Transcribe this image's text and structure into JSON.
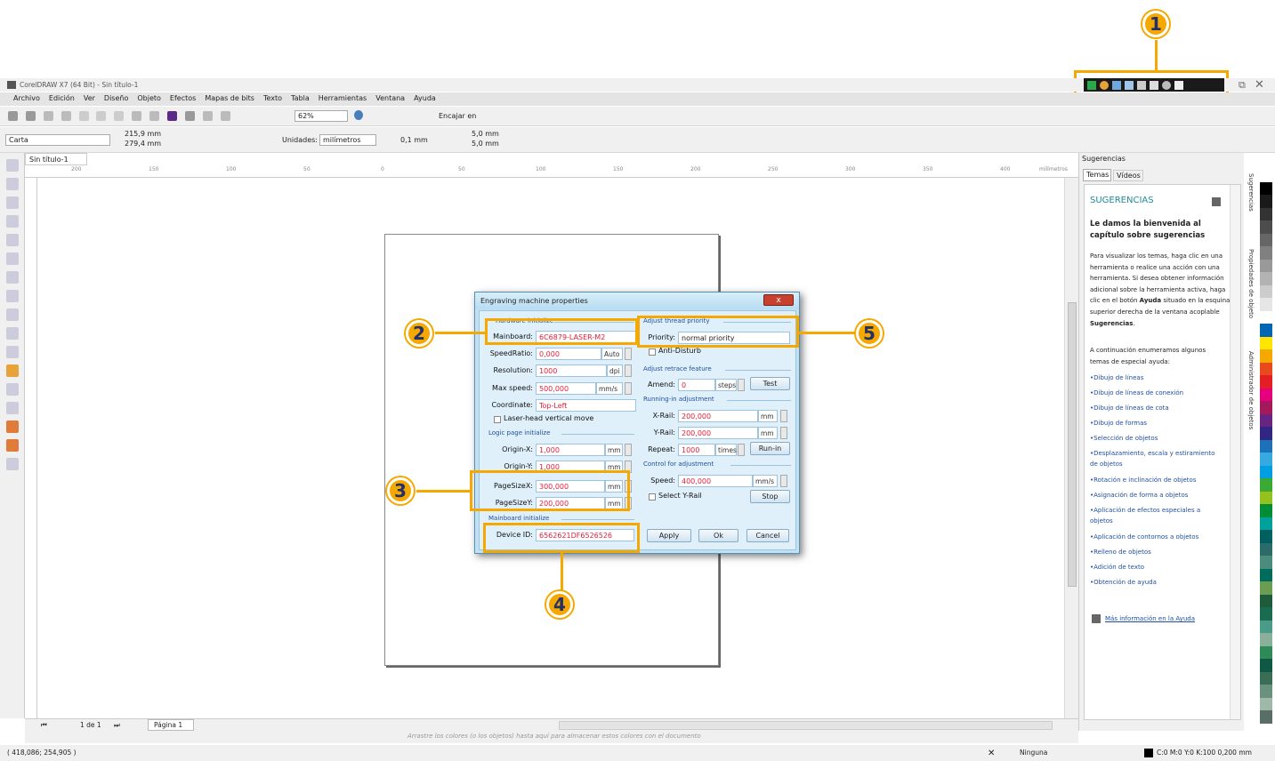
{
  "app": {
    "title": "CorelDRAW X7 (64 Bit) - Sin título-1"
  },
  "menu": [
    "Archivo",
    "Edición",
    "Ver",
    "Diseño",
    "Objeto",
    "Efectos",
    "Mapas de bits",
    "Texto",
    "Tabla",
    "Herramientas",
    "Ventana",
    "Ayuda"
  ],
  "toolbar": {
    "zoom": "62%",
    "snap_label": "Encajar en"
  },
  "propbar": {
    "page_size": "Carta",
    "width": "215,9 mm",
    "height": "279,4 mm",
    "units_label": "Unidades:",
    "units": "milímetros",
    "nudge": "0,1 mm",
    "dup_x": "5,0 mm",
    "dup_y": "5,0 mm"
  },
  "doc_tab": "Sin título-1",
  "ruler": {
    "h": [
      "200",
      "150",
      "100",
      "50",
      "0",
      "50",
      "100",
      "150",
      "200",
      "250",
      "300",
      "350",
      "400"
    ],
    "unit": "milímetros"
  },
  "dialog": {
    "title": "Engraving machine properties",
    "close": "x",
    "hw_section": "Hardware initialize",
    "mainboard_label": "Mainboard:",
    "mainboard": "6C6879-LASER-M2",
    "speedratio_label": "SpeedRatio:",
    "speedratio": "0,000",
    "speedratio_unit": "Auto",
    "resolution_label": "Resolution:",
    "resolution": "1000",
    "resolution_unit": "dpi",
    "maxspeed_label": "Max speed:",
    "maxspeed": "500,000",
    "maxspeed_unit": "mm/s",
    "coordinate_label": "Coordinate:",
    "coordinate": "Top-Left",
    "laser_vertical": "Laser-head vertical move",
    "logic_section": "Logic page initialize",
    "originx_label": "Origin-X:",
    "originx": "1,000",
    "originx_unit": "mm",
    "originy_label": "Origin-Y:",
    "originy": "1,000",
    "originy_unit": "mm",
    "pagesizex_label": "PageSizeX:",
    "pagesizex": "300,000",
    "pagesizex_unit": "mm",
    "pagesizey_label": "PageSizeY:",
    "pagesizey": "200,000",
    "pagesizey_unit": "mm",
    "mainboard_section": "Mainboard initialize",
    "deviceid_label": "Device ID:",
    "deviceid": "6562621DF6526526",
    "thread_section": "Adjust thread priority",
    "priority_label": "Priority:",
    "priority": "normal priority",
    "antidisturb": "Anti-Disturb",
    "retrace_section": "Adjust retrace feature",
    "amend_label": "Amend:",
    "amend": "0",
    "amend_unit": "steps",
    "test_btn": "Test",
    "runin_section": "Running-in adjustment",
    "xrail_label": "X-Rail:",
    "xrail": "200,000",
    "xrail_unit": "mm",
    "yrail_label": "Y-Rail:",
    "yrail": "200,000",
    "yrail_unit": "mm",
    "repeat_label": "Repeat:",
    "repeat": "1000",
    "repeat_unit": "times",
    "runin_btn": "Run-in",
    "control_section": "Control for adjustment",
    "speed_label": "Speed:",
    "speed": "400,000",
    "speed_unit": "mm/s",
    "selectyrail": "Select Y-Rail",
    "stop_btn": "Stop",
    "apply_btn": "Apply",
    "ok_btn": "Ok",
    "cancel_btn": "Cancel"
  },
  "annotations": [
    "1",
    "2",
    "3",
    "4",
    "5"
  ],
  "hints": {
    "panel_title": "Sugerencias",
    "tab_topics": "Temas",
    "tab_videos": "Vídeos",
    "heading": "SUGERENCIAS",
    "welcome": "Le damos la bienvenida al capítulo sobre sugerencias",
    "intro_a": "Para visualizar los temas, haga clic en una herramienta o realice una acción con una herramienta. Si desea obtener información adicional sobre la herramienta activa, haga clic en el botón ",
    "intro_ayuda": "Ayuda",
    "intro_b": " situado en la esquina superior derecha de la ventana acoplable ",
    "intro_sug": "Sugerencias",
    "intro_c": ".",
    "list_intro": "A continuación enumeramos algunos temas de especial ayuda:",
    "topics": [
      "Dibujo de líneas",
      "Dibujo de líneas de conexión",
      "Dibujo de líneas de cota",
      "Dibujo de formas",
      "Selección de objetos",
      "Desplazamiento, escala y estiramiento de objetos",
      "Rotación e inclinación de objetos",
      "Asignación de forma a objetos",
      "Aplicación de efectos especiales a objetos",
      "Aplicación de contornos a objetos",
      "Relleno de objetos",
      "Adición de texto",
      "Obtención de ayuda"
    ],
    "more": "Más información en la Ayuda",
    "side_tabs": [
      "Sugerencias",
      "Propiedades de objeto",
      "Administrador de objetos"
    ]
  },
  "pagebar": {
    "count": "1 de 1",
    "page": "Página 1"
  },
  "docbar": {
    "hint": "Arrastre los colores (o los objetos) hasta aquí para almacenar estos colores con el documento"
  },
  "status": {
    "coords": "( 418,086; 254,905 )",
    "fill": "Ninguna",
    "outline": "C:0 M:0 Y:0 K:100  0,200 mm"
  },
  "palette": [
    "#ffffff",
    "#000000",
    "#1a1a1a",
    "#333333",
    "#4d4d4d",
    "#666666",
    "#808080",
    "#999999",
    "#b3b3b3",
    "#cccccc",
    "#e6e6e6",
    "#ffffff",
    "#0066b3",
    "#ffe600",
    "#f5a800",
    "#e8491d",
    "#e31e24",
    "#e6007e",
    "#a3195b",
    "#662483",
    "#312783",
    "#1d71b8",
    "#36a9e1",
    "#009fe3",
    "#3aaa35",
    "#95c11f",
    "#008d36",
    "#00a19a",
    "#005f5f",
    "#2d6a6a",
    "#4c8c7c",
    "#006c5b",
    "#6a9c52",
    "#1d5b3a",
    "#1b6b52",
    "#4a9c88",
    "#8ab09b",
    "#2e8b57",
    "#0f5845",
    "#3a6d56",
    "#6a907e",
    "#a0b8a8",
    "#586e66"
  ]
}
